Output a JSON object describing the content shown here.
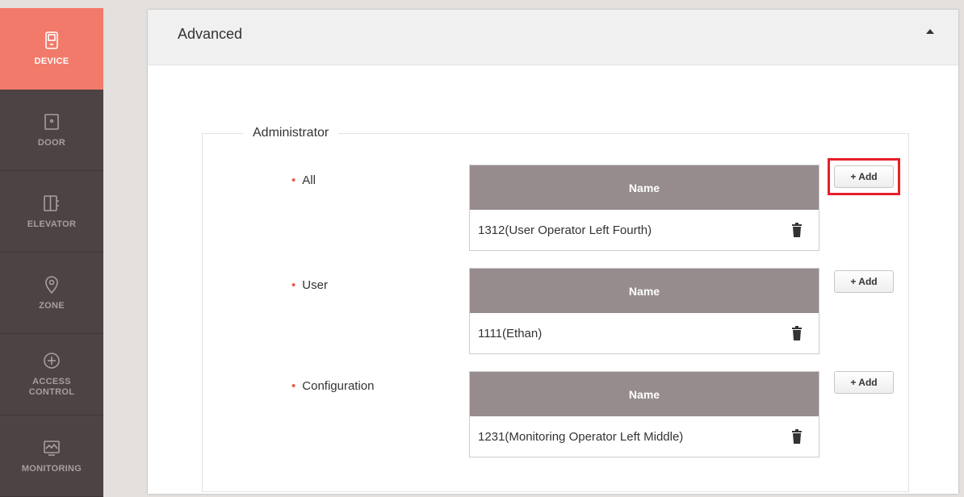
{
  "sidebar": {
    "items": [
      {
        "label": "DEVICE",
        "icon": "device-icon",
        "active": true
      },
      {
        "label": "DOOR",
        "icon": "door-icon",
        "active": false
      },
      {
        "label": "ELEVATOR",
        "icon": "elevator-icon",
        "active": false
      },
      {
        "label": "ZONE",
        "icon": "zone-icon",
        "active": false
      },
      {
        "label": "ACCESS\nCONTROL",
        "icon": "access-control-icon",
        "active": false
      },
      {
        "label": "MONITORING",
        "icon": "monitoring-icon",
        "active": false
      }
    ]
  },
  "panel": {
    "title": "Advanced",
    "section": {
      "legend": "Administrator",
      "rows": [
        {
          "label": "All",
          "column_header": "Name",
          "entries": [
            "1312(User Operator Left Fourth)"
          ],
          "add_label": "+ Add",
          "highlighted": true
        },
        {
          "label": "User",
          "column_header": "Name",
          "entries": [
            "1111(Ethan)"
          ],
          "add_label": "+ Add",
          "highlighted": false
        },
        {
          "label": "Configuration",
          "column_header": "Name",
          "entries": [
            "1231(Monitoring Operator Left Middle)"
          ],
          "add_label": "+ Add",
          "highlighted": false
        }
      ]
    }
  },
  "colors": {
    "accent": "#f27a6a",
    "sidebar_bg": "#4d4344",
    "table_header": "#978c8d",
    "highlight": "#e5202a",
    "bullet": "#e8584b"
  }
}
